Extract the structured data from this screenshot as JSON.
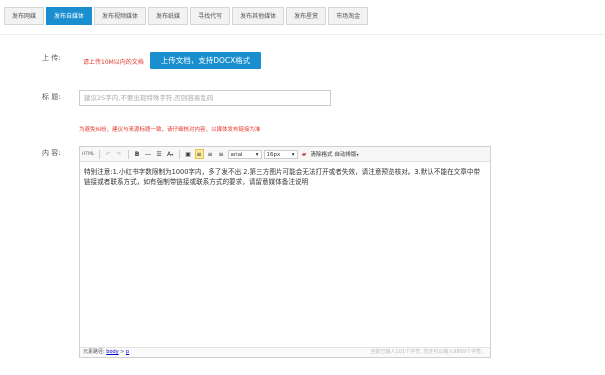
{
  "tabs": [
    {
      "label": "发布网媒",
      "active": false
    },
    {
      "label": "发布自媒体",
      "active": true
    },
    {
      "label": "发布视频媒体",
      "active": false
    },
    {
      "label": "发布纸媒",
      "active": false
    },
    {
      "label": "寻找代写",
      "active": false
    },
    {
      "label": "发布其他媒体",
      "active": false
    },
    {
      "label": "发布星赏",
      "active": false
    },
    {
      "label": "市场淘金",
      "active": false
    }
  ],
  "upload": {
    "label": "上 传:",
    "hint": "请上传10M以内的文档",
    "button": "上传文档，支持DOCX格式"
  },
  "title": {
    "label": "标 题:",
    "placeholder": "建议25字内,不要出现特殊字符,否则容易乱码",
    "warning": "为避免纠纷，建议与来源标题一致，请仔细核对内容，以媒体发布链接为准"
  },
  "content": {
    "label": "内 容:",
    "text": "特别注意:1.小红书字数限制为1000字内，多了发不出  2.第三方图片可能会无法打开或者失效，请注意预览核对。3.默认不能在文章中带链接或者联系方式，如有强制带链接或联系方式的要求，请留意媒体备注说明"
  },
  "toolbar": {
    "html": "HTML",
    "bold": "B",
    "font_color": "A",
    "font_family": "arial",
    "font_size": "16px",
    "clear_format": "清除格式",
    "auto_layout": "自动排版"
  },
  "statusbar": {
    "path_label": "元素路径:",
    "path_body": "body",
    "path_sep": " > ",
    "path_p": "p",
    "count": "当前已输入101个字符, 您还可以输入9899个字符。"
  }
}
